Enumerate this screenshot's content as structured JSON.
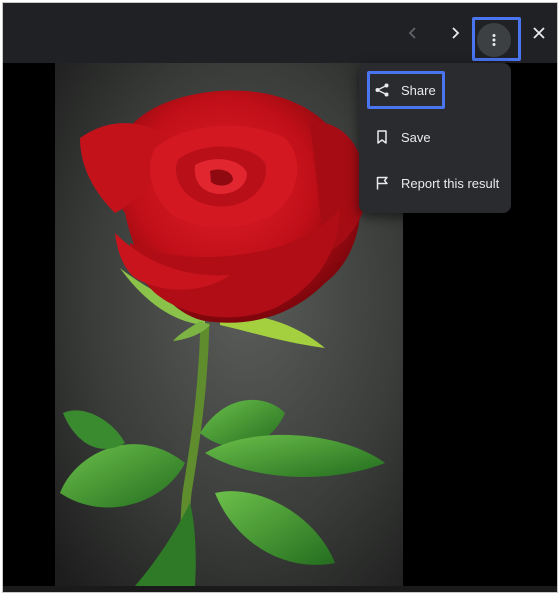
{
  "toolbar": {
    "prev_icon": "chevron-left-icon",
    "next_icon": "chevron-right-icon",
    "more_icon": "more-vert-icon",
    "close_icon": "close-icon"
  },
  "menu": {
    "items": [
      {
        "label": "Share",
        "icon": "share-icon"
      },
      {
        "label": "Save",
        "icon": "bookmark-icon"
      },
      {
        "label": "Report this result",
        "icon": "flag-icon"
      }
    ]
  },
  "image": {
    "subject": "red-rose-photo"
  },
  "colors": {
    "topbar": "#202124",
    "menu_bg": "#2a2b2f",
    "highlight": "#4a74f0",
    "text": "#e8eaed"
  }
}
